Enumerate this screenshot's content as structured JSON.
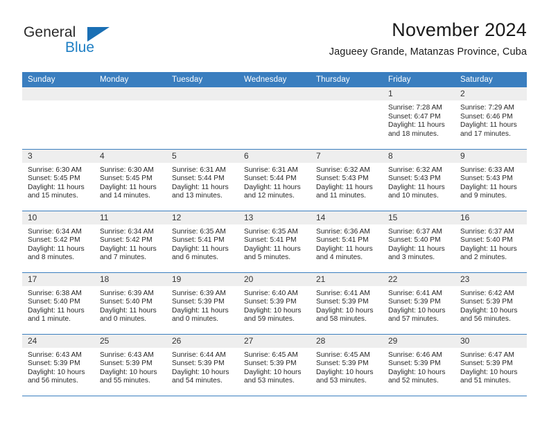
{
  "brand": {
    "name_part1": "General",
    "name_part2": "Blue",
    "triangle_color": "#1a6fb4",
    "blue_text_color": "#1f7fc4"
  },
  "header": {
    "title": "November 2024",
    "subtitle": "Jagueey Grande, Matanzas Province, Cuba"
  },
  "theme": {
    "header_bg": "#3a7ebf",
    "daynum_bg": "#eeeeee",
    "row_border": "#3a7ebf",
    "text": "#262626"
  },
  "weekdays": [
    "Sunday",
    "Monday",
    "Tuesday",
    "Wednesday",
    "Thursday",
    "Friday",
    "Saturday"
  ],
  "weeks": [
    [
      {
        "day": "",
        "sunrise": "",
        "sunset": "",
        "daylight1": "",
        "daylight2": ""
      },
      {
        "day": "",
        "sunrise": "",
        "sunset": "",
        "daylight1": "",
        "daylight2": ""
      },
      {
        "day": "",
        "sunrise": "",
        "sunset": "",
        "daylight1": "",
        "daylight2": ""
      },
      {
        "day": "",
        "sunrise": "",
        "sunset": "",
        "daylight1": "",
        "daylight2": ""
      },
      {
        "day": "",
        "sunrise": "",
        "sunset": "",
        "daylight1": "",
        "daylight2": ""
      },
      {
        "day": "1",
        "sunrise": "Sunrise: 7:28 AM",
        "sunset": "Sunset: 6:47 PM",
        "daylight1": "Daylight: 11 hours",
        "daylight2": "and 18 minutes."
      },
      {
        "day": "2",
        "sunrise": "Sunrise: 7:29 AM",
        "sunset": "Sunset: 6:46 PM",
        "daylight1": "Daylight: 11 hours",
        "daylight2": "and 17 minutes."
      }
    ],
    [
      {
        "day": "3",
        "sunrise": "Sunrise: 6:30 AM",
        "sunset": "Sunset: 5:45 PM",
        "daylight1": "Daylight: 11 hours",
        "daylight2": "and 15 minutes."
      },
      {
        "day": "4",
        "sunrise": "Sunrise: 6:30 AM",
        "sunset": "Sunset: 5:45 PM",
        "daylight1": "Daylight: 11 hours",
        "daylight2": "and 14 minutes."
      },
      {
        "day": "5",
        "sunrise": "Sunrise: 6:31 AM",
        "sunset": "Sunset: 5:44 PM",
        "daylight1": "Daylight: 11 hours",
        "daylight2": "and 13 minutes."
      },
      {
        "day": "6",
        "sunrise": "Sunrise: 6:31 AM",
        "sunset": "Sunset: 5:44 PM",
        "daylight1": "Daylight: 11 hours",
        "daylight2": "and 12 minutes."
      },
      {
        "day": "7",
        "sunrise": "Sunrise: 6:32 AM",
        "sunset": "Sunset: 5:43 PM",
        "daylight1": "Daylight: 11 hours",
        "daylight2": "and 11 minutes."
      },
      {
        "day": "8",
        "sunrise": "Sunrise: 6:32 AM",
        "sunset": "Sunset: 5:43 PM",
        "daylight1": "Daylight: 11 hours",
        "daylight2": "and 10 minutes."
      },
      {
        "day": "9",
        "sunrise": "Sunrise: 6:33 AM",
        "sunset": "Sunset: 5:43 PM",
        "daylight1": "Daylight: 11 hours",
        "daylight2": "and 9 minutes."
      }
    ],
    [
      {
        "day": "10",
        "sunrise": "Sunrise: 6:34 AM",
        "sunset": "Sunset: 5:42 PM",
        "daylight1": "Daylight: 11 hours",
        "daylight2": "and 8 minutes."
      },
      {
        "day": "11",
        "sunrise": "Sunrise: 6:34 AM",
        "sunset": "Sunset: 5:42 PM",
        "daylight1": "Daylight: 11 hours",
        "daylight2": "and 7 minutes."
      },
      {
        "day": "12",
        "sunrise": "Sunrise: 6:35 AM",
        "sunset": "Sunset: 5:41 PM",
        "daylight1": "Daylight: 11 hours",
        "daylight2": "and 6 minutes."
      },
      {
        "day": "13",
        "sunrise": "Sunrise: 6:35 AM",
        "sunset": "Sunset: 5:41 PM",
        "daylight1": "Daylight: 11 hours",
        "daylight2": "and 5 minutes."
      },
      {
        "day": "14",
        "sunrise": "Sunrise: 6:36 AM",
        "sunset": "Sunset: 5:41 PM",
        "daylight1": "Daylight: 11 hours",
        "daylight2": "and 4 minutes."
      },
      {
        "day": "15",
        "sunrise": "Sunrise: 6:37 AM",
        "sunset": "Sunset: 5:40 PM",
        "daylight1": "Daylight: 11 hours",
        "daylight2": "and 3 minutes."
      },
      {
        "day": "16",
        "sunrise": "Sunrise: 6:37 AM",
        "sunset": "Sunset: 5:40 PM",
        "daylight1": "Daylight: 11 hours",
        "daylight2": "and 2 minutes."
      }
    ],
    [
      {
        "day": "17",
        "sunrise": "Sunrise: 6:38 AM",
        "sunset": "Sunset: 5:40 PM",
        "daylight1": "Daylight: 11 hours",
        "daylight2": "and 1 minute."
      },
      {
        "day": "18",
        "sunrise": "Sunrise: 6:39 AM",
        "sunset": "Sunset: 5:40 PM",
        "daylight1": "Daylight: 11 hours",
        "daylight2": "and 0 minutes."
      },
      {
        "day": "19",
        "sunrise": "Sunrise: 6:39 AM",
        "sunset": "Sunset: 5:39 PM",
        "daylight1": "Daylight: 11 hours",
        "daylight2": "and 0 minutes."
      },
      {
        "day": "20",
        "sunrise": "Sunrise: 6:40 AM",
        "sunset": "Sunset: 5:39 PM",
        "daylight1": "Daylight: 10 hours",
        "daylight2": "and 59 minutes."
      },
      {
        "day": "21",
        "sunrise": "Sunrise: 6:41 AM",
        "sunset": "Sunset: 5:39 PM",
        "daylight1": "Daylight: 10 hours",
        "daylight2": "and 58 minutes."
      },
      {
        "day": "22",
        "sunrise": "Sunrise: 6:41 AM",
        "sunset": "Sunset: 5:39 PM",
        "daylight1": "Daylight: 10 hours",
        "daylight2": "and 57 minutes."
      },
      {
        "day": "23",
        "sunrise": "Sunrise: 6:42 AM",
        "sunset": "Sunset: 5:39 PM",
        "daylight1": "Daylight: 10 hours",
        "daylight2": "and 56 minutes."
      }
    ],
    [
      {
        "day": "24",
        "sunrise": "Sunrise: 6:43 AM",
        "sunset": "Sunset: 5:39 PM",
        "daylight1": "Daylight: 10 hours",
        "daylight2": "and 56 minutes."
      },
      {
        "day": "25",
        "sunrise": "Sunrise: 6:43 AM",
        "sunset": "Sunset: 5:39 PM",
        "daylight1": "Daylight: 10 hours",
        "daylight2": "and 55 minutes."
      },
      {
        "day": "26",
        "sunrise": "Sunrise: 6:44 AM",
        "sunset": "Sunset: 5:39 PM",
        "daylight1": "Daylight: 10 hours",
        "daylight2": "and 54 minutes."
      },
      {
        "day": "27",
        "sunrise": "Sunrise: 6:45 AM",
        "sunset": "Sunset: 5:39 PM",
        "daylight1": "Daylight: 10 hours",
        "daylight2": "and 53 minutes."
      },
      {
        "day": "28",
        "sunrise": "Sunrise: 6:45 AM",
        "sunset": "Sunset: 5:39 PM",
        "daylight1": "Daylight: 10 hours",
        "daylight2": "and 53 minutes."
      },
      {
        "day": "29",
        "sunrise": "Sunrise: 6:46 AM",
        "sunset": "Sunset: 5:39 PM",
        "daylight1": "Daylight: 10 hours",
        "daylight2": "and 52 minutes."
      },
      {
        "day": "30",
        "sunrise": "Sunrise: 6:47 AM",
        "sunset": "Sunset: 5:39 PM",
        "daylight1": "Daylight: 10 hours",
        "daylight2": "and 51 minutes."
      }
    ]
  ]
}
